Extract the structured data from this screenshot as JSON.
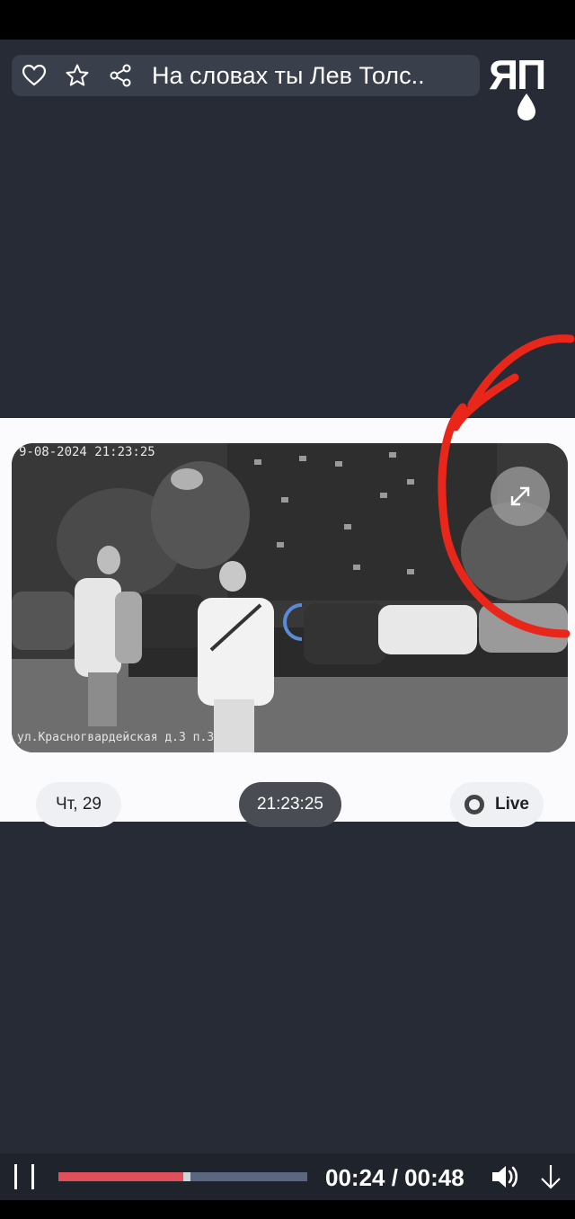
{
  "header": {
    "title": "На словах ты Лев Толс..",
    "icons": [
      "heart-icon",
      "star-icon",
      "share-icon"
    ]
  },
  "logo": {
    "text": "ЯП"
  },
  "video": {
    "camera_timestamp": "9-08-2024 21:23:25",
    "camera_address": "ул.Красногвардейская д.3 п.3",
    "day_chip": "Чт, 29",
    "time_chip": "21:23:25",
    "live_chip": "Live"
  },
  "player": {
    "time_display": "00:24 / 00:48",
    "progress_fraction": 0.5,
    "buffer_fraction": 0.53
  },
  "colors": {
    "background": "#262b36",
    "progress": "#e0505a",
    "annotation": "#e8271a",
    "spinner": "#5b8bd6"
  }
}
